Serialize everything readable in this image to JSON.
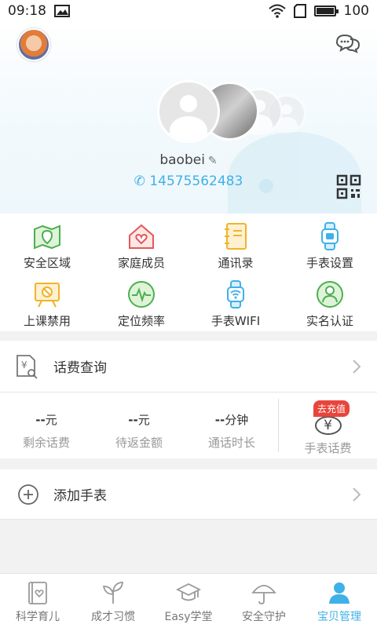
{
  "status_bar": {
    "time": "09:18",
    "battery_level": 100,
    "battery_text": "100"
  },
  "profile": {
    "username": "baobei",
    "phone": "14575562483"
  },
  "grid": {
    "items": [
      {
        "label": "安全区域",
        "icon": "map-shield-icon",
        "color": "#4caf50"
      },
      {
        "label": "家庭成员",
        "icon": "home-heart-icon",
        "color": "#e05a5a"
      },
      {
        "label": "通讯录",
        "icon": "contact-book-icon",
        "color": "#f0b429"
      },
      {
        "label": "手表设置",
        "icon": "watch-icon",
        "color": "#3fb1e8"
      },
      {
        "label": "上课禁用",
        "icon": "class-ban-icon",
        "color": "#f0b429"
      },
      {
        "label": "定位频率",
        "icon": "pulse-icon",
        "color": "#4caf50"
      },
      {
        "label": "手表WIFI",
        "icon": "watch-wifi-icon",
        "color": "#3fb1e8"
      },
      {
        "label": "实名认证",
        "icon": "user-verify-icon",
        "color": "#4caf50"
      }
    ]
  },
  "fee": {
    "title": "话费查询",
    "stats": [
      {
        "value": "--",
        "unit": "元",
        "label": "剩余话费"
      },
      {
        "value": "--",
        "unit": "元",
        "label": "待返金额"
      },
      {
        "value": "--",
        "unit": "分钟",
        "label": "通话时长"
      }
    ],
    "recharge": {
      "badge": "去充值",
      "symbol": "¥",
      "label": "手表话费"
    }
  },
  "add_watch": {
    "label": "添加手表"
  },
  "tabs": [
    {
      "label": "科学育儿",
      "icon": "book-heart-icon"
    },
    {
      "label": "成才习惯",
      "icon": "sprout-icon"
    },
    {
      "label": "Easy学堂",
      "icon": "graduation-cap-icon"
    },
    {
      "label": "安全守护",
      "icon": "umbrella-icon"
    },
    {
      "label": "宝贝管理",
      "icon": "person-icon",
      "active": true
    }
  ],
  "colors": {
    "accent": "#3fb1e8",
    "badge": "#e8453c"
  }
}
